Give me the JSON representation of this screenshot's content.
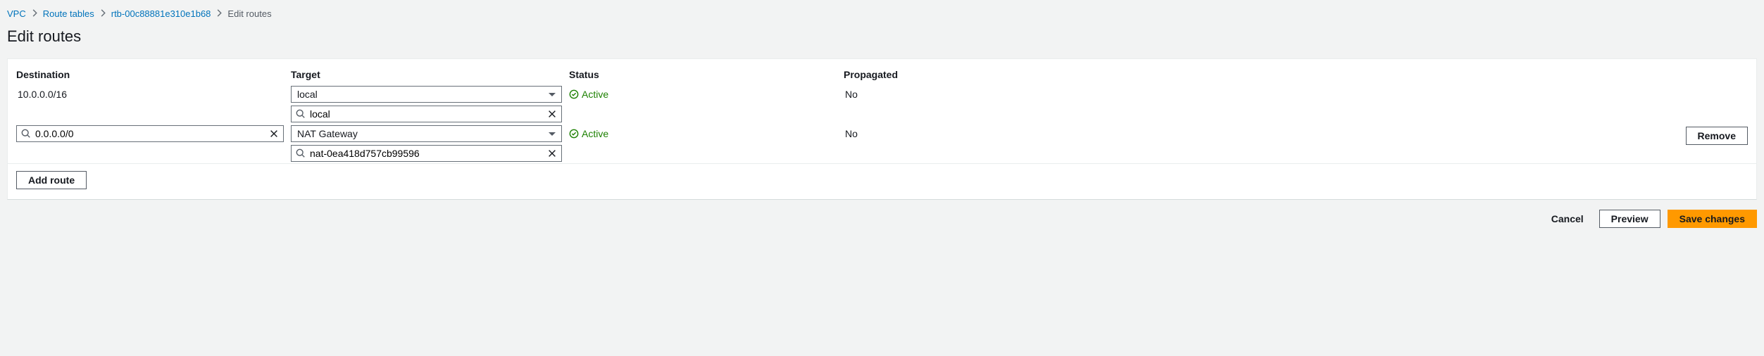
{
  "breadcrumb": {
    "items": [
      {
        "label": "VPC"
      },
      {
        "label": "Route tables"
      },
      {
        "label": "rtb-00c88881e310e1b68"
      }
    ],
    "current": "Edit routes"
  },
  "page_title": "Edit routes",
  "columns": {
    "destination": "Destination",
    "target": "Target",
    "status": "Status",
    "propagated": "Propagated"
  },
  "routes": [
    {
      "destination_static": "10.0.0.0/16",
      "target_select": "local",
      "target_search": "local",
      "status": "Active",
      "propagated": "No"
    },
    {
      "destination_search": "0.0.0.0/0",
      "target_select": "NAT Gateway",
      "target_search": "nat-0ea418d757cb99596",
      "status": "Active",
      "propagated": "No",
      "remove_label": "Remove"
    }
  ],
  "buttons": {
    "add_route": "Add route",
    "cancel": "Cancel",
    "preview": "Preview",
    "save": "Save changes"
  }
}
